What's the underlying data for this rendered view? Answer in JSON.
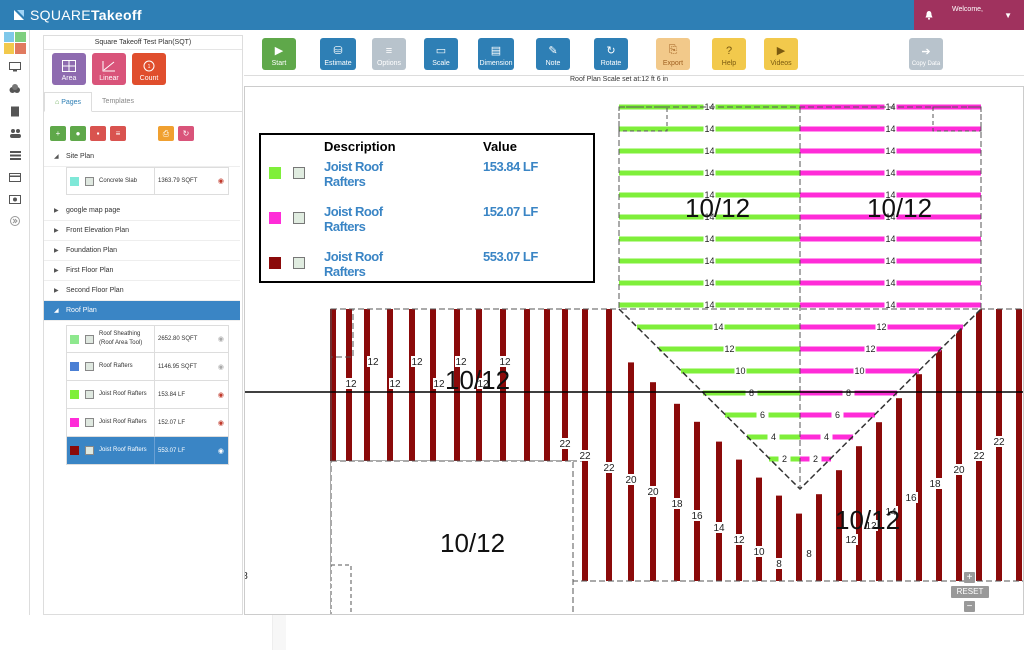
{
  "app": {
    "brand_square": "SQUARE",
    "brand_takeoff": "Takeoff",
    "welcome": "Welcome,"
  },
  "panel": {
    "title": "Square Takeoff Test Plan(SQT)",
    "tools": [
      {
        "label": "Area",
        "color": "#8e6bb0"
      },
      {
        "label": "Linear",
        "color": "#d9547a"
      },
      {
        "label": "Count",
        "color": "#e04e2d"
      }
    ],
    "tabs": {
      "pages": "Pages",
      "templates": "Templates"
    },
    "pages": [
      {
        "name": "Site Plan",
        "items": [
          {
            "name": "Concrete Slab",
            "value": "1363.79 SQFT",
            "color": "#7fe8d8"
          }
        ]
      },
      {
        "name": "google map page"
      },
      {
        "name": "Front Elevation Plan"
      },
      {
        "name": "Foundation Plan"
      },
      {
        "name": "First Floor Plan"
      },
      {
        "name": "Second Floor Plan"
      },
      {
        "name": "Roof Plan",
        "items": [
          {
            "name": "Roof Sheathing (Roof Area Tool)",
            "value": "2652.80 SQFT",
            "color": "#8ee88e"
          },
          {
            "name": "Roof Rafters",
            "value": "1146.95 SQFT",
            "color": "#4a7fd4"
          },
          {
            "name": "Joist Roof Rafters",
            "value": "153.84 LF",
            "color": "#7fef3a"
          },
          {
            "name": "Joist Roof Rafters",
            "value": "152.07 LF",
            "color": "#ff2cd8"
          },
          {
            "name": "Joist Roof Rafters",
            "value": "553.07 LF",
            "color": "#8b0a0a"
          }
        ]
      }
    ]
  },
  "toolbar": [
    {
      "label": "Start",
      "color": "#5fa84a",
      "icon": "play-icon"
    },
    {
      "label": "Estimate",
      "color": "#2e7fb5",
      "icon": "coins-icon"
    },
    {
      "label": "Options",
      "color": "#b8c3cc",
      "icon": "menu-icon"
    },
    {
      "label": "Scale",
      "color": "#2e7fb5",
      "icon": "ruler-icon"
    },
    {
      "label": "Dimension",
      "color": "#2e7fb5",
      "icon": "dimension-icon"
    },
    {
      "label": "Note",
      "color": "#2e7fb5",
      "icon": "note-icon"
    },
    {
      "label": "Rotate",
      "color": "#2e7fb5",
      "icon": "rotate-icon"
    },
    {
      "label": "Export",
      "color": "#f2c98a",
      "icon": "export-icon"
    },
    {
      "label": "Help",
      "color": "#f2c94c",
      "icon": "help-icon"
    },
    {
      "label": "Videos",
      "color": "#f2c94c",
      "icon": "video-icon"
    },
    {
      "label": "Copy Data",
      "color": "#b8c3cc",
      "icon": "copy-icon"
    }
  ],
  "scale_text": "Roof Plan Scale set at:12 ft 6 in",
  "legend": {
    "desc_header": "Description",
    "value_header": "Value",
    "rows": [
      {
        "desc": "Joist Roof Rafters",
        "value": "153.84 LF",
        "color": "#7fef3a"
      },
      {
        "desc": "Joist Roof Rafters",
        "value": "152.07 LF",
        "color": "#ff2cd8"
      },
      {
        "desc": "Joist Roof Rafters",
        "value": "553.07 LF",
        "color": "#8b0a0a"
      }
    ]
  },
  "plan": {
    "pitch_label": "10/12",
    "green_labels": [
      "14",
      "14",
      "14",
      "14",
      "14",
      "14",
      "14",
      "14",
      "14",
      "14",
      "14",
      "12",
      "10",
      "8",
      "6",
      "4",
      "2"
    ],
    "magenta_labels": [
      "14",
      "14",
      "14",
      "14",
      "14",
      "14",
      "14",
      "14",
      "14",
      "14",
      "12",
      "12",
      "10",
      "8",
      "6",
      "4",
      "2"
    ],
    "left_labels": [
      "12",
      "12",
      "12",
      "12",
      "12",
      "12",
      "12",
      "12"
    ],
    "mid_left_labels": [
      "22",
      "22",
      "22",
      "20",
      "20",
      "18",
      "16",
      "14",
      "12",
      "10",
      "8",
      "8"
    ],
    "right_labels": [
      "8",
      "12",
      "12",
      "14",
      "16",
      "18",
      "20",
      "22",
      "22"
    ],
    "zoom_in": "+",
    "zoom_out": "−",
    "reset": "RESET"
  }
}
